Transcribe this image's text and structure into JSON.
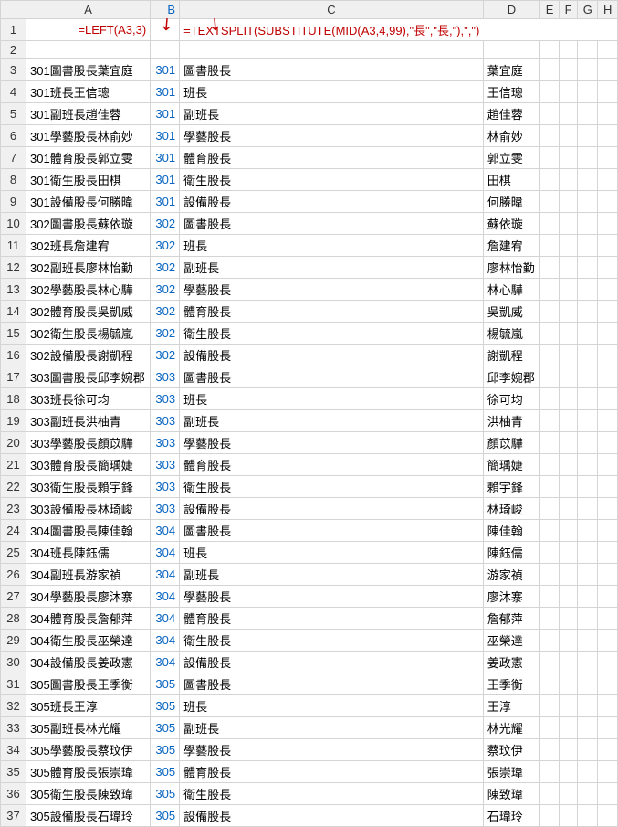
{
  "columns": [
    "A",
    "B",
    "C",
    "D",
    "E",
    "F",
    "G",
    "H"
  ],
  "formula1": "=LEFT(A3,3)",
  "formula2": "=TEXTSPLIT(SUBSTITUTE(MID(A3,4,99),\"長\",\"長,\"),\",\")",
  "rows": [
    {
      "n": "3",
      "a": "301圖書股長葉宜庭",
      "b": "301",
      "c": "圖書股長",
      "d": "葉宜庭"
    },
    {
      "n": "4",
      "a": "301班長王信璁",
      "b": "301",
      "c": "班長",
      "d": "王信璁"
    },
    {
      "n": "5",
      "a": "301副班長趙佳蓉",
      "b": "301",
      "c": "副班長",
      "d": "趙佳蓉"
    },
    {
      "n": "6",
      "a": "301學藝股長林俞妙",
      "b": "301",
      "c": "學藝股長",
      "d": "林俞妙"
    },
    {
      "n": "7",
      "a": "301體育股長郭立雯",
      "b": "301",
      "c": "體育股長",
      "d": "郭立雯"
    },
    {
      "n": "8",
      "a": "301衛生股長田棋",
      "b": "301",
      "c": "衛生股長",
      "d": "田棋"
    },
    {
      "n": "9",
      "a": "301設備股長何勝暐",
      "b": "301",
      "c": "設備股長",
      "d": "何勝暐"
    },
    {
      "n": "10",
      "a": "302圖書股長蘇依璇",
      "b": "302",
      "c": "圖書股長",
      "d": "蘇依璇"
    },
    {
      "n": "11",
      "a": "302班長詹建宥",
      "b": "302",
      "c": "班長",
      "d": "詹建宥"
    },
    {
      "n": "12",
      "a": "302副班長廖林怡勤",
      "b": "302",
      "c": "副班長",
      "d": "廖林怡勤"
    },
    {
      "n": "13",
      "a": "302學藝股長林心驊",
      "b": "302",
      "c": "學藝股長",
      "d": "林心驊"
    },
    {
      "n": "14",
      "a": "302體育股長吳凱威",
      "b": "302",
      "c": "體育股長",
      "d": "吳凱威"
    },
    {
      "n": "15",
      "a": "302衛生股長楊毓嵐",
      "b": "302",
      "c": "衛生股長",
      "d": "楊毓嵐"
    },
    {
      "n": "16",
      "a": "302設備股長謝凱程",
      "b": "302",
      "c": "設備股長",
      "d": "謝凱程"
    },
    {
      "n": "17",
      "a": "303圖書股長邱李婉郡",
      "b": "303",
      "c": "圖書股長",
      "d": "邱李婉郡"
    },
    {
      "n": "18",
      "a": "303班長徐可均",
      "b": "303",
      "c": "班長",
      "d": "徐可均"
    },
    {
      "n": "19",
      "a": "303副班長洪柚青",
      "b": "303",
      "c": "副班長",
      "d": "洪柚青"
    },
    {
      "n": "20",
      "a": "303學藝股長顏苡驊",
      "b": "303",
      "c": "學藝股長",
      "d": "顏苡驊"
    },
    {
      "n": "21",
      "a": "303體育股長簡瑀婕",
      "b": "303",
      "c": "體育股長",
      "d": "簡瑀婕"
    },
    {
      "n": "22",
      "a": "303衛生股長賴宇鋒",
      "b": "303",
      "c": "衛生股長",
      "d": "賴宇鋒"
    },
    {
      "n": "23",
      "a": "303設備股長林琦峻",
      "b": "303",
      "c": "設備股長",
      "d": "林琦峻"
    },
    {
      "n": "24",
      "a": "304圖書股長陳佳翰",
      "b": "304",
      "c": "圖書股長",
      "d": "陳佳翰"
    },
    {
      "n": "25",
      "a": "304班長陳鈺儒",
      "b": "304",
      "c": "班長",
      "d": "陳鈺儒"
    },
    {
      "n": "26",
      "a": "304副班長游家禎",
      "b": "304",
      "c": "副班長",
      "d": "游家禎"
    },
    {
      "n": "27",
      "a": "304學藝股長廖沐寨",
      "b": "304",
      "c": "學藝股長",
      "d": "廖沐寨"
    },
    {
      "n": "28",
      "a": "304體育股長詹郁萍",
      "b": "304",
      "c": "體育股長",
      "d": "詹郁萍"
    },
    {
      "n": "29",
      "a": "304衛生股長巫榮達",
      "b": "304",
      "c": "衛生股長",
      "d": "巫榮達"
    },
    {
      "n": "30",
      "a": "304設備股長姜政憲",
      "b": "304",
      "c": "設備股長",
      "d": "姜政憲"
    },
    {
      "n": "31",
      "a": "305圖書股長王季衡",
      "b": "305",
      "c": "圖書股長",
      "d": "王季衡"
    },
    {
      "n": "32",
      "a": "305班長王淳",
      "b": "305",
      "c": "班長",
      "d": "王淳"
    },
    {
      "n": "33",
      "a": "305副班長林光耀",
      "b": "305",
      "c": "副班長",
      "d": "林光耀"
    },
    {
      "n": "34",
      "a": "305學藝股長蔡玟伊",
      "b": "305",
      "c": "學藝股長",
      "d": "蔡玟伊"
    },
    {
      "n": "35",
      "a": "305體育股長張崇瑋",
      "b": "305",
      "c": "體育股長",
      "d": "張崇瑋"
    },
    {
      "n": "36",
      "a": "305衛生股長陳致瑋",
      "b": "305",
      "c": "衛生股長",
      "d": "陳致瑋"
    },
    {
      "n": "37",
      "a": "305設備股長石瑋玲",
      "b": "305",
      "c": "設備股長",
      "d": "石瑋玲"
    }
  ]
}
